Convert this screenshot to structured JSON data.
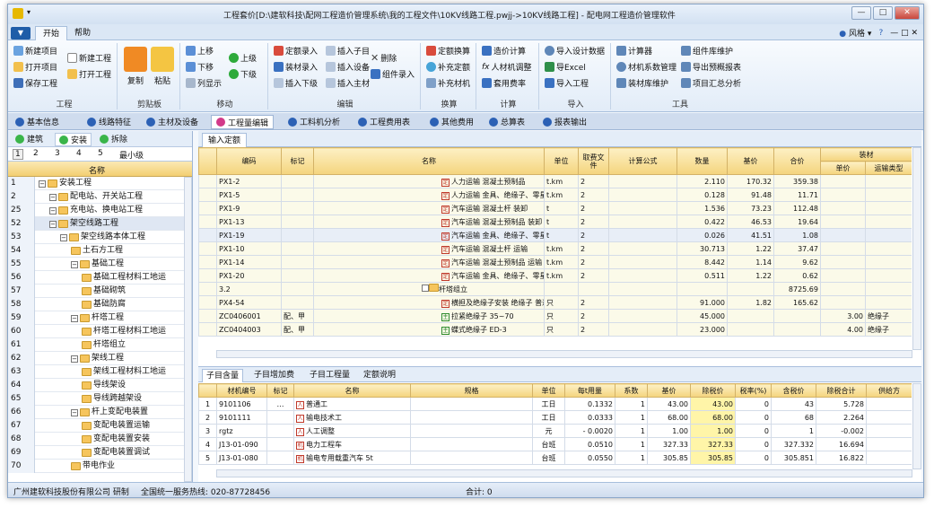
{
  "window": {
    "title": "工程套价[D:\\建软科技\\配网工程造价管理系统\\我的工程文件\\10KV线路工程.pwjj->10KV线路工程] - 配电网工程造价管理软件",
    "buttons": [
      "—",
      "□",
      "✕"
    ]
  },
  "ribbon_tabs": [
    "开始",
    "帮助"
  ],
  "ribbon_right": {
    "style": "风格",
    "help": "?"
  },
  "ribbon": {
    "g1": {
      "label": "工程",
      "items": [
        "新建项目",
        "打开项目",
        "保存工程",
        "新建工程",
        "打开工程"
      ]
    },
    "g2": {
      "label": "剪贴板",
      "items": [
        "复制",
        "粘贴"
      ]
    },
    "g3": {
      "label": "移动",
      "items": [
        "上移",
        "下移",
        "列显示",
        "上级",
        "下级"
      ]
    },
    "g4": {
      "label": "编辑",
      "items": [
        "定额录入",
        "插入子目",
        "删除",
        "装材录入",
        "插入设备",
        "组件录入",
        "插入下级",
        "插入主材"
      ]
    },
    "g5": {
      "label": "换算",
      "items": [
        "定额换算",
        "补充定额",
        "补充材机"
      ]
    },
    "g6": {
      "label": "计算",
      "items": [
        "造价计算",
        "人材机调整",
        "套用费率"
      ]
    },
    "g7": {
      "label": "导入",
      "items": [
        "导入设计数据",
        "导Excel",
        "导入工程"
      ]
    },
    "g8": {
      "label": "工具",
      "items": [
        "计算器",
        "组件库维护",
        "材机系数管理",
        "导出预概报表",
        "装材库维护",
        "项目汇总分析"
      ]
    }
  },
  "nav": [
    "基本信息",
    "线路特征",
    "主材及设备",
    "工程量编辑",
    "工料机分析",
    "工程费用表",
    "其他费用",
    "总算表",
    "报表输出"
  ],
  "left": {
    "tabs": [
      "建筑",
      "安装",
      "拆除"
    ],
    "levels": [
      "1",
      "2",
      "3",
      "4",
      "5",
      "最小级"
    ],
    "header": "名称",
    "rows": [
      {
        "n": "1",
        "label": "安装工程",
        "lvl": 0
      },
      {
        "n": "2",
        "label": "配电站、开关站工程",
        "lvl": 1
      },
      {
        "n": "25",
        "label": "充电站、换电站工程",
        "lvl": 1
      },
      {
        "n": "52",
        "label": "架空线路工程",
        "lvl": 1
      },
      {
        "n": "53",
        "label": "架空线路本体工程",
        "lvl": 2
      },
      {
        "n": "54",
        "label": "土石方工程",
        "lvl": 3
      },
      {
        "n": "55",
        "label": "基础工程",
        "lvl": 3
      },
      {
        "n": "56",
        "label": "基础工程材料工地运",
        "lvl": 4
      },
      {
        "n": "57",
        "label": "基础砌筑",
        "lvl": 4
      },
      {
        "n": "58",
        "label": "基础防腐",
        "lvl": 4
      },
      {
        "n": "59",
        "label": "杆塔工程",
        "lvl": 3
      },
      {
        "n": "60",
        "label": "杆塔工程材料工地运",
        "lvl": 4
      },
      {
        "n": "61",
        "label": "杆塔组立",
        "lvl": 4
      },
      {
        "n": "62",
        "label": "架线工程",
        "lvl": 3
      },
      {
        "n": "63",
        "label": "架线工程材料工地运",
        "lvl": 4
      },
      {
        "n": "64",
        "label": "导线架设",
        "lvl": 4
      },
      {
        "n": "65",
        "label": "导线跨越架设",
        "lvl": 4
      },
      {
        "n": "66",
        "label": "杆上变配电装置",
        "lvl": 3
      },
      {
        "n": "67",
        "label": "变配电装置运输",
        "lvl": 4
      },
      {
        "n": "68",
        "label": "变配电装置安装",
        "lvl": 4
      },
      {
        "n": "69",
        "label": "变配电装置调试",
        "lvl": 4
      },
      {
        "n": "70",
        "label": "带电作业",
        "lvl": 3
      }
    ]
  },
  "main": {
    "tab": "输入定额",
    "headers": [
      "编码",
      "标记",
      "名称",
      "单位",
      "取费文件",
      "计算公式",
      "数量",
      "基价",
      "合价",
      "装材",
      "单价",
      "运输类型"
    ],
    "rows": [
      {
        "code": "PX1-2",
        "mark": "",
        "tag": "定",
        "name": "人力运输 混凝土预制品",
        "unit": "t.km",
        "fee": "2",
        "qty": "2.110",
        "price": "170.32",
        "total": "359.38",
        "up": "",
        "tt": ""
      },
      {
        "code": "PX1-5",
        "mark": "",
        "tag": "定",
        "name": "人力运输 金具、绝缘子、零星钢材",
        "unit": "t.km",
        "fee": "2",
        "qty": "0.128",
        "price": "91.48",
        "total": "11.71",
        "up": "",
        "tt": ""
      },
      {
        "code": "PX1-9",
        "mark": "",
        "tag": "定",
        "name": "汽车运输 混凝土杆 装卸",
        "unit": "t",
        "fee": "2",
        "qty": "1.536",
        "price": "73.23",
        "total": "112.48",
        "up": "",
        "tt": ""
      },
      {
        "code": "PX1-13",
        "mark": "",
        "tag": "定",
        "name": "汽车运输 混凝土预制品 装卸",
        "unit": "t",
        "fee": "2",
        "qty": "0.422",
        "price": "46.53",
        "total": "19.64",
        "up": "",
        "tt": ""
      },
      {
        "code": "PX1-19",
        "mark": "",
        "tag": "定",
        "name": "汽车运输 金具、绝缘子、零星钢材 装卸",
        "unit": "t",
        "fee": "2",
        "qty": "0.026",
        "price": "41.51",
        "total": "1.08",
        "up": "",
        "tt": ""
      },
      {
        "code": "PX1-10",
        "mark": "",
        "tag": "定",
        "name": "汽车运输 混凝土杆 运输",
        "unit": "t.km",
        "fee": "2",
        "qty": "30.713",
        "price": "1.22",
        "total": "37.47",
        "up": "",
        "tt": ""
      },
      {
        "code": "PX1-14",
        "mark": "",
        "tag": "定",
        "name": "汽车运输 混凝土预制品 运输",
        "unit": "t.km",
        "fee": "2",
        "qty": "8.442",
        "price": "1.14",
        "total": "9.62",
        "up": "",
        "tt": ""
      },
      {
        "code": "PX1-20",
        "mark": "",
        "tag": "定",
        "name": "汽车运输 金具、绝缘子、零星钢材 运输",
        "unit": "t.km",
        "fee": "2",
        "qty": "0.511",
        "price": "1.22",
        "total": "0.62",
        "up": "",
        "tt": ""
      },
      {
        "code": "3.2",
        "mark": "",
        "tag": "F",
        "name": "杆塔组立",
        "unit": "",
        "fee": "",
        "qty": "",
        "price": "",
        "total": "8725.69",
        "up": "",
        "tt": ""
      },
      {
        "code": "PX4-54",
        "mark": "",
        "tag": "定",
        "name": "横担及绝缘子安装 绝缘子 普通",
        "unit": "只",
        "fee": "2",
        "qty": "91.000",
        "price": "1.82",
        "total": "165.62",
        "up": "",
        "tt": ""
      },
      {
        "code": "ZC0406001",
        "mark": "配、甲",
        "tag": "主",
        "name": "拉紧绝缘子 35~70",
        "unit": "只",
        "fee": "2",
        "qty": "45.000",
        "price": "",
        "total": "",
        "up": "3.00",
        "tt": "绝缘子"
      },
      {
        "code": "ZC0404003",
        "mark": "配、甲",
        "tag": "主",
        "name": "蝶式绝缘子 ED-3",
        "unit": "只",
        "fee": "2",
        "qty": "23.000",
        "price": "",
        "total": "",
        "up": "4.00",
        "tt": "绝缘子"
      }
    ]
  },
  "bottom": {
    "tabs": [
      "子目含量",
      "子目增加费",
      "子目工程量",
      "定额说明"
    ],
    "headers": [
      "材机编号",
      "标记",
      "名称",
      "规格",
      "单位",
      "每t用量",
      "系数",
      "基价",
      "除税价",
      "税率(%)",
      "含税价",
      "除税合计",
      "供给方"
    ],
    "rows": [
      {
        "n": "1",
        "code": "9101106",
        "mark": "…",
        "tag": "人",
        "name": "普通工",
        "spec": "",
        "unit": "工日",
        "use": "0.1332",
        "coef": "1",
        "base": "43.00",
        "notax": "43.00",
        "rate": "0",
        "tax": "43",
        "sum": "5.728"
      },
      {
        "n": "2",
        "code": "9101111",
        "mark": "",
        "tag": "人",
        "name": "输电技术工",
        "spec": "",
        "unit": "工日",
        "use": "0.0333",
        "coef": "1",
        "base": "68.00",
        "notax": "68.00",
        "rate": "0",
        "tax": "68",
        "sum": "2.264"
      },
      {
        "n": "3",
        "code": "rgtz",
        "mark": "",
        "tag": "人",
        "name": "人工调整",
        "spec": "",
        "unit": "元",
        "use": "- 0.0020",
        "coef": "1",
        "base": "1.00",
        "notax": "1.00",
        "rate": "0",
        "tax": "1",
        "sum": "-0.002"
      },
      {
        "n": "4",
        "code": "J13-01-090",
        "mark": "",
        "tag": "机",
        "name": "电力工程车",
        "spec": "",
        "unit": "台班",
        "use": "0.0510",
        "coef": "1",
        "base": "327.33",
        "notax": "327.33",
        "rate": "0",
        "tax": "327.332",
        "sum": "16.694"
      },
      {
        "n": "5",
        "code": "J13-01-080",
        "mark": "",
        "tag": "机",
        "name": "输电专用载重汽车 5t",
        "spec": "",
        "unit": "台班",
        "use": "0.0550",
        "coef": "1",
        "base": "305.85",
        "notax": "305.85",
        "rate": "0",
        "tax": "305.851",
        "sum": "16.822"
      }
    ]
  },
  "status": {
    "company": "广州建软科技股份有限公司 研制",
    "hotline": "全国统一服务热线: 020-87728456",
    "total": "合计: 0"
  }
}
